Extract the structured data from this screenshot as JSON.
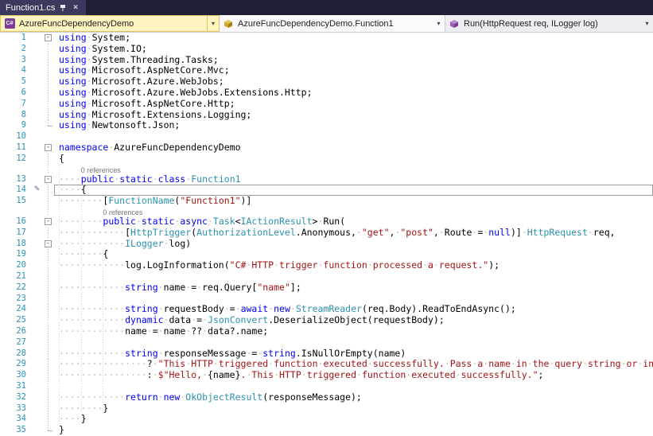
{
  "tab": {
    "title": "Function1.cs"
  },
  "navbar": {
    "project": "AzureFuncDependencyDemo",
    "type": "AzureFuncDependencyDemo.Function1",
    "member": "Run(HttpRequest req, ILogger log)"
  },
  "icons": {
    "csharp_badge": "C#",
    "dropdown_arrow": "▾",
    "close": "✕",
    "fold_collapse": "-",
    "pencil": "✎"
  },
  "colors": {
    "keyword": "#0000ff",
    "type_name": "#2b91af",
    "string_literal": "#a31515",
    "line_number": "#2b91af",
    "tab_bar_bg": "#1e1e36",
    "active_tab_bg": "#3a3a5e",
    "combo_highlight_bg": "#fdf4bf",
    "combo_highlight_border": "#e5c365"
  },
  "codelens_label": "0 references",
  "editor": {
    "rows": [
      {
        "n": "1",
        "f": "m",
        "t": [
          [
            "kw",
            "using"
          ],
          [
            "ws",
            "·"
          ],
          [
            "pl",
            "System;"
          ]
        ]
      },
      {
        "n": "2",
        "f": "v",
        "t": [
          [
            "kw",
            "using"
          ],
          [
            "ws",
            "·"
          ],
          [
            "pl",
            "System.IO;"
          ]
        ]
      },
      {
        "n": "3",
        "f": "v",
        "t": [
          [
            "kw",
            "using"
          ],
          [
            "ws",
            "·"
          ],
          [
            "pl",
            "System.Threading.Tasks;"
          ]
        ]
      },
      {
        "n": "4",
        "f": "v",
        "t": [
          [
            "kw",
            "using"
          ],
          [
            "ws",
            "·"
          ],
          [
            "pl",
            "Microsoft.AspNetCore.Mvc;"
          ]
        ]
      },
      {
        "n": "5",
        "f": "v",
        "t": [
          [
            "kw",
            "using"
          ],
          [
            "ws",
            "·"
          ],
          [
            "pl",
            "Microsoft.Azure.WebJobs;"
          ]
        ]
      },
      {
        "n": "6",
        "f": "v",
        "t": [
          [
            "kw",
            "using"
          ],
          [
            "ws",
            "·"
          ],
          [
            "pl",
            "Microsoft.Azure.WebJobs.Extensions.Http;"
          ]
        ]
      },
      {
        "n": "7",
        "f": "v",
        "t": [
          [
            "kw",
            "using"
          ],
          [
            "ws",
            "·"
          ],
          [
            "pl",
            "Microsoft.AspNetCore.Http;"
          ]
        ]
      },
      {
        "n": "8",
        "f": "v",
        "t": [
          [
            "kw",
            "using"
          ],
          [
            "ws",
            "·"
          ],
          [
            "pl",
            "Microsoft.Extensions.Logging;"
          ]
        ]
      },
      {
        "n": "9",
        "f": "e",
        "t": [
          [
            "kw",
            "using"
          ],
          [
            "ws",
            "·"
          ],
          [
            "pl",
            "Newtonsoft.Json;"
          ]
        ]
      },
      {
        "n": "10",
        "t": []
      },
      {
        "n": "11",
        "f": "m",
        "t": [
          [
            "kw",
            "namespace"
          ],
          [
            "ws",
            "·"
          ],
          [
            "pl",
            "AzureFuncDependencyDemo"
          ]
        ]
      },
      {
        "n": "12",
        "f": "v",
        "t": [
          [
            "pl",
            "{"
          ]
        ]
      },
      {
        "k": "l",
        "f": "v",
        "indent": 4,
        "text": "0 references",
        "g": [
          0
        ]
      },
      {
        "n": "13",
        "f": "m",
        "g": [
          0
        ],
        "t": [
          [
            "ws",
            "····"
          ],
          [
            "kw",
            "public"
          ],
          [
            "ws",
            "·"
          ],
          [
            "kw",
            "static"
          ],
          [
            "ws",
            "·"
          ],
          [
            "kw",
            "class"
          ],
          [
            "ws",
            "·"
          ],
          [
            "type",
            "Function1"
          ]
        ]
      },
      {
        "n": "14",
        "f": "v",
        "g": [
          0
        ],
        "cur": true,
        "glyph": "pencil",
        "t": [
          [
            "ws",
            "····"
          ],
          [
            "pl",
            "{"
          ]
        ]
      },
      {
        "n": "15",
        "f": "v",
        "g": [
          0,
          4
        ],
        "t": [
          [
            "ws",
            "········"
          ],
          [
            "pl",
            "["
          ],
          [
            "type",
            "FunctionName"
          ],
          [
            "pl",
            "("
          ],
          [
            "str",
            "\"Function1\""
          ],
          [
            "pl",
            ")]"
          ]
        ]
      },
      {
        "k": "l",
        "f": "v",
        "indent": 8,
        "text": "0 references",
        "g": [
          0,
          4
        ]
      },
      {
        "n": "16",
        "f": "m",
        "g": [
          0,
          4
        ],
        "t": [
          [
            "ws",
            "········"
          ],
          [
            "kw",
            "public"
          ],
          [
            "ws",
            "·"
          ],
          [
            "kw",
            "static"
          ],
          [
            "ws",
            "·"
          ],
          [
            "kw",
            "async"
          ],
          [
            "ws",
            "·"
          ],
          [
            "type",
            "Task"
          ],
          [
            "pl",
            "<"
          ],
          [
            "type",
            "IActionResult"
          ],
          [
            "pl",
            ">"
          ],
          [
            "ws",
            "·"
          ],
          [
            "pl",
            "Run("
          ]
        ]
      },
      {
        "n": "17",
        "f": "v",
        "g": [
          0,
          4
        ],
        "t": [
          [
            "ws",
            "············"
          ],
          [
            "pl",
            "["
          ],
          [
            "type",
            "HttpTrigger"
          ],
          [
            "pl",
            "("
          ],
          [
            "type",
            "AuthorizationLevel"
          ],
          [
            "pl",
            ".Anonymous,"
          ],
          [
            "ws",
            "·"
          ],
          [
            "str",
            "\"get\""
          ],
          [
            "pl",
            ","
          ],
          [
            "ws",
            "·"
          ],
          [
            "str",
            "\"post\""
          ],
          [
            "pl",
            ","
          ],
          [
            "ws",
            "·"
          ],
          [
            "pl",
            "Route"
          ],
          [
            "ws",
            "·"
          ],
          [
            "pl",
            "="
          ],
          [
            "ws",
            "·"
          ],
          [
            "kw",
            "null"
          ],
          [
            "pl",
            ")]"
          ],
          [
            "ws",
            "·"
          ],
          [
            "type",
            "HttpRequest"
          ],
          [
            "ws",
            "·"
          ],
          [
            "pl",
            "req,"
          ]
        ]
      },
      {
        "n": "18",
        "f": "m",
        "g": [
          0,
          4
        ],
        "t": [
          [
            "ws",
            "············"
          ],
          [
            "type",
            "ILogger"
          ],
          [
            "ws",
            "·"
          ],
          [
            "pl",
            "log)"
          ]
        ]
      },
      {
        "n": "19",
        "f": "v",
        "g": [
          0,
          4
        ],
        "t": [
          [
            "ws",
            "········"
          ],
          [
            "pl",
            "{"
          ]
        ]
      },
      {
        "n": "20",
        "f": "v",
        "g": [
          0,
          4,
          8
        ],
        "t": [
          [
            "ws",
            "············"
          ],
          [
            "pl",
            "log.LogInformation("
          ],
          [
            "str",
            "\"C#·HTTP·trigger·function·processed·a·request.\""
          ],
          [
            "pl",
            ");"
          ]
        ]
      },
      {
        "n": "21",
        "f": "v",
        "g": [
          0,
          4,
          8
        ],
        "t": []
      },
      {
        "n": "22",
        "f": "v",
        "g": [
          0,
          4,
          8
        ],
        "t": [
          [
            "ws",
            "············"
          ],
          [
            "kw",
            "string"
          ],
          [
            "ws",
            "·"
          ],
          [
            "pl",
            "name"
          ],
          [
            "ws",
            "·"
          ],
          [
            "pl",
            "="
          ],
          [
            "ws",
            "·"
          ],
          [
            "pl",
            "req.Query["
          ],
          [
            "str",
            "\"name\""
          ],
          [
            "pl",
            "];"
          ]
        ]
      },
      {
        "n": "23",
        "f": "v",
        "g": [
          0,
          4,
          8
        ],
        "t": []
      },
      {
        "n": "24",
        "f": "v",
        "g": [
          0,
          4,
          8
        ],
        "t": [
          [
            "ws",
            "············"
          ],
          [
            "kw",
            "string"
          ],
          [
            "ws",
            "·"
          ],
          [
            "pl",
            "requestBody"
          ],
          [
            "ws",
            "·"
          ],
          [
            "pl",
            "="
          ],
          [
            "ws",
            "·"
          ],
          [
            "kw",
            "await"
          ],
          [
            "ws",
            "·"
          ],
          [
            "kw",
            "new"
          ],
          [
            "ws",
            "·"
          ],
          [
            "type",
            "StreamReader"
          ],
          [
            "pl",
            "(req.Body).ReadToEndAsync();"
          ]
        ]
      },
      {
        "n": "25",
        "f": "v",
        "g": [
          0,
          4,
          8
        ],
        "t": [
          [
            "ws",
            "············"
          ],
          [
            "kw",
            "dynamic"
          ],
          [
            "ws",
            "·"
          ],
          [
            "pl",
            "data"
          ],
          [
            "ws",
            "·"
          ],
          [
            "pl",
            "="
          ],
          [
            "ws",
            "·"
          ],
          [
            "type",
            "JsonConvert"
          ],
          [
            "pl",
            ".DeserializeObject(requestBody);"
          ]
        ]
      },
      {
        "n": "26",
        "f": "v",
        "g": [
          0,
          4,
          8
        ],
        "t": [
          [
            "ws",
            "············"
          ],
          [
            "pl",
            "name"
          ],
          [
            "ws",
            "·"
          ],
          [
            "pl",
            "="
          ],
          [
            "ws",
            "·"
          ],
          [
            "pl",
            "name"
          ],
          [
            "ws",
            "·"
          ],
          [
            "pl",
            "??"
          ],
          [
            "ws",
            "·"
          ],
          [
            "pl",
            "data?.name;"
          ]
        ]
      },
      {
        "n": "27",
        "f": "v",
        "g": [
          0,
          4,
          8
        ],
        "t": []
      },
      {
        "n": "28",
        "f": "v",
        "g": [
          0,
          4,
          8
        ],
        "t": [
          [
            "ws",
            "············"
          ],
          [
            "kw",
            "string"
          ],
          [
            "ws",
            "·"
          ],
          [
            "pl",
            "responseMessage"
          ],
          [
            "ws",
            "·"
          ],
          [
            "pl",
            "="
          ],
          [
            "ws",
            "·"
          ],
          [
            "kw",
            "string"
          ],
          [
            "pl",
            ".IsNullOrEmpty(name)"
          ]
        ]
      },
      {
        "n": "29",
        "f": "v",
        "g": [
          0,
          4,
          8
        ],
        "t": [
          [
            "ws",
            "················"
          ],
          [
            "pl",
            "?"
          ],
          [
            "ws",
            "·"
          ],
          [
            "str",
            "\"This·HTTP·triggered·function·executed·successfully.·Pass·a·name·in·the·query·string·or·in·the·request·body"
          ]
        ]
      },
      {
        "n": "30",
        "f": "v",
        "g": [
          0,
          4,
          8
        ],
        "t": [
          [
            "ws",
            "················"
          ],
          [
            "pl",
            ":"
          ],
          [
            "ws",
            "·"
          ],
          [
            "str",
            "$\"Hello,·"
          ],
          [
            "pl",
            "{name}"
          ],
          [
            "str",
            ".·This·HTTP·triggered·function·executed·successfully.\""
          ],
          [
            "pl",
            ";"
          ]
        ]
      },
      {
        "n": "31",
        "f": "v",
        "g": [
          0,
          4,
          8
        ],
        "t": []
      },
      {
        "n": "32",
        "f": "v",
        "g": [
          0,
          4,
          8
        ],
        "t": [
          [
            "ws",
            "············"
          ],
          [
            "kw",
            "return"
          ],
          [
            "ws",
            "·"
          ],
          [
            "kw",
            "new"
          ],
          [
            "ws",
            "·"
          ],
          [
            "type",
            "OkObjectResult"
          ],
          [
            "pl",
            "(responseMessage);"
          ]
        ]
      },
      {
        "n": "33",
        "f": "v",
        "g": [
          0,
          4
        ],
        "t": [
          [
            "ws",
            "········"
          ],
          [
            "pl",
            "}"
          ]
        ]
      },
      {
        "n": "34",
        "f": "v",
        "g": [
          0
        ],
        "t": [
          [
            "ws",
            "····"
          ],
          [
            "pl",
            "}"
          ]
        ]
      },
      {
        "n": "35",
        "f": "e",
        "t": [
          [
            "pl",
            "}"
          ]
        ]
      }
    ]
  }
}
